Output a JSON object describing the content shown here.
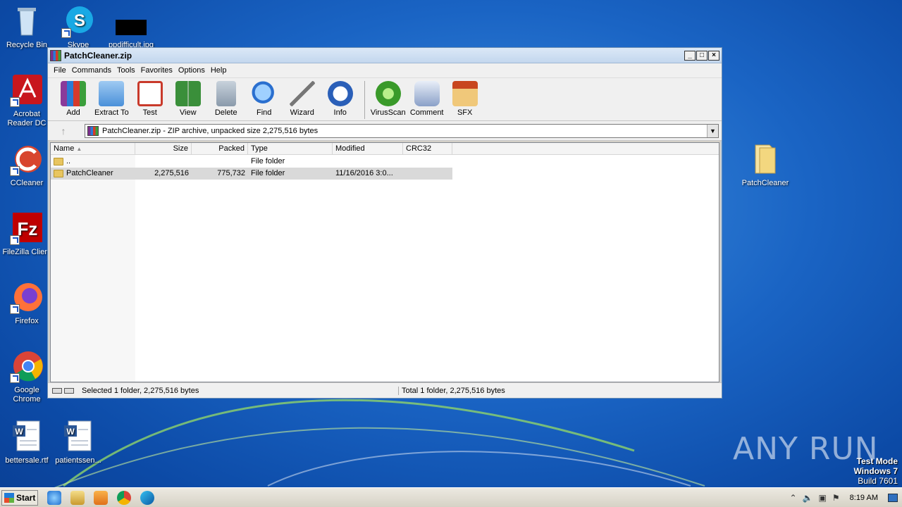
{
  "desktop": {
    "icons": [
      {
        "label": "Recycle Bin"
      },
      {
        "label": "Skype"
      },
      {
        "label": "ppdifficult.jpg"
      },
      {
        "label": "Acrobat Reader DC"
      },
      {
        "label": "CCleaner"
      },
      {
        "label": "FileZilla Client"
      },
      {
        "label": "Firefox"
      },
      {
        "label": "Google Chrome"
      },
      {
        "label": "bettersale.rtf"
      },
      {
        "label": "patientssen..."
      },
      {
        "label": "PatchCleaner"
      }
    ],
    "watermark": {
      "brand": "ANY RUN",
      "line1": "Test Mode",
      "line2": "Windows 7",
      "line3": "Build 7601"
    }
  },
  "window": {
    "title": "PatchCleaner.zip",
    "controls": {
      "minimize": "_",
      "maximize": "□",
      "close": "×"
    },
    "menu": [
      "File",
      "Commands",
      "Tools",
      "Favorites",
      "Options",
      "Help"
    ],
    "toolbar": [
      {
        "label": "Add",
        "icon": "add-archive-icon",
        "color": "#8a3a9a"
      },
      {
        "label": "Extract To",
        "icon": "extract-folder-icon",
        "color": "#4a90d9"
      },
      {
        "label": "Test",
        "icon": "test-clipboard-icon",
        "color": "#c93a2b"
      },
      {
        "label": "View",
        "icon": "view-book-icon",
        "color": "#3a8f3a"
      },
      {
        "label": "Delete",
        "icon": "trash-icon",
        "color": "#8a9aab"
      },
      {
        "label": "Find",
        "icon": "magnifier-icon",
        "color": "#2a6fcf"
      },
      {
        "label": "Wizard",
        "icon": "wand-icon",
        "color": "#c0c0c0"
      },
      {
        "label": "Info",
        "icon": "info-icon",
        "color": "#2a5fb8"
      },
      {
        "label": "VirusScan",
        "icon": "virus-scan-icon",
        "color": "#3a9a2a"
      },
      {
        "label": "Comment",
        "icon": "comment-icon",
        "color": "#8aa0c8"
      },
      {
        "label": "SFX",
        "icon": "sfx-box-icon",
        "color": "#d8a040"
      }
    ],
    "address": "PatchCleaner.zip - ZIP archive, unpacked size 2,275,516 bytes",
    "columns": [
      "Name",
      "Size",
      "Packed",
      "Type",
      "Modified",
      "CRC32"
    ],
    "rows": [
      {
        "name": "..",
        "size": "",
        "packed": "",
        "type": "File folder",
        "modified": "",
        "crc": ""
      },
      {
        "name": "PatchCleaner",
        "size": "2,275,516",
        "packed": "775,732",
        "type": "File folder",
        "modified": "11/16/2016 3:0...",
        "crc": ""
      }
    ],
    "status_left": "Selected 1 folder, 2,275,516 bytes",
    "status_right": "Total 1 folder, 2,275,516 bytes"
  },
  "taskbar": {
    "start_label": "Start",
    "clock": "8:19 AM"
  }
}
